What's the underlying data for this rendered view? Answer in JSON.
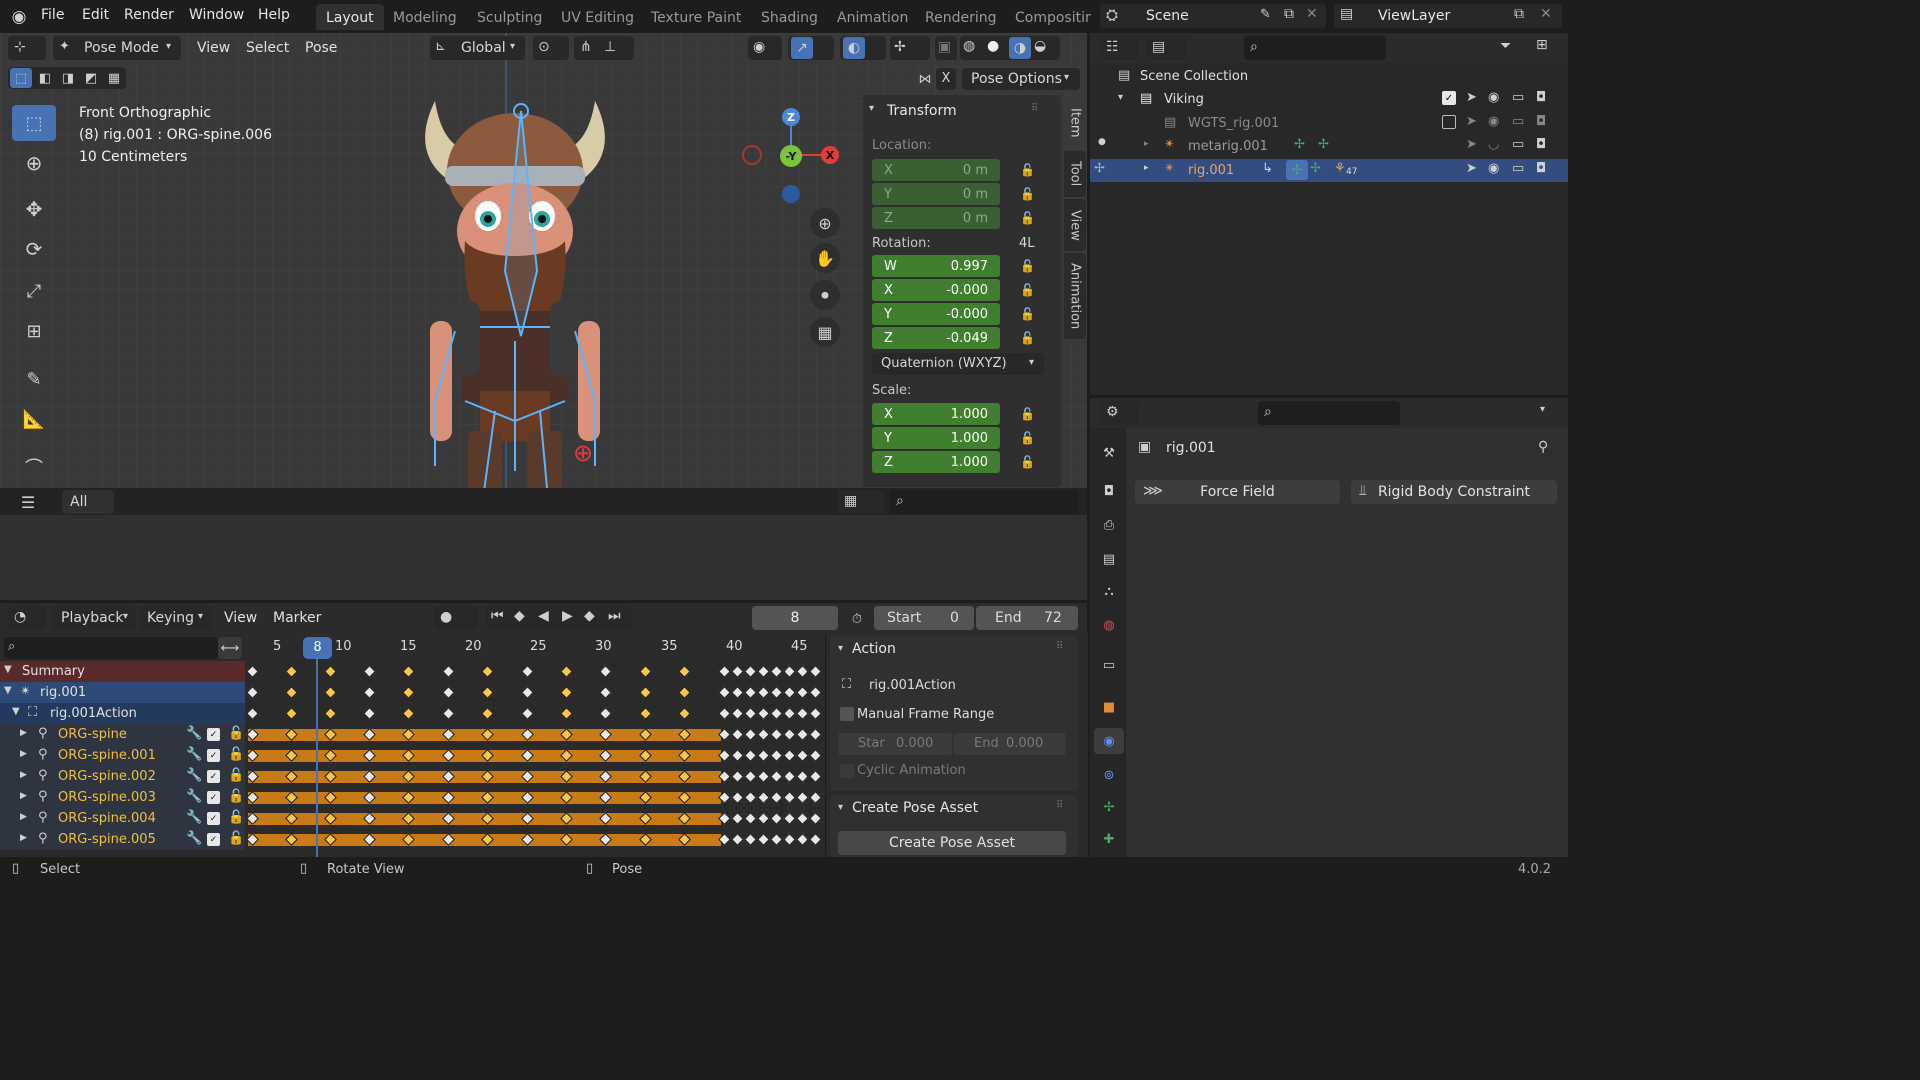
{
  "menu": {
    "file": "File",
    "edit": "Edit",
    "render": "Render",
    "window": "Window",
    "help": "Help"
  },
  "workspaces": [
    "Layout",
    "Modeling",
    "Sculpting",
    "UV Editing",
    "Texture Paint",
    "Shading",
    "Animation",
    "Rendering",
    "Compositing"
  ],
  "scene": {
    "name": "Scene",
    "view_layer": "ViewLayer"
  },
  "viewport": {
    "mode": "Pose Mode",
    "view": "View",
    "select": "Select",
    "pose": "Pose",
    "transform_orientation": "Global",
    "info_line1": "Front Orthographic",
    "info_line2": "(8) rig.001 : ORG-spine.006",
    "info_line3": "10 Centimeters",
    "pose_options": "Pose Options",
    "x_button": "X",
    "filter_all": "All"
  },
  "gizmo": {
    "z": "Z",
    "y": "-Y",
    "x": "X"
  },
  "npanel": {
    "transform_header": "Transform",
    "location_label": "Location:",
    "location": [
      {
        "axis": "X",
        "value": "0 m"
      },
      {
        "axis": "Y",
        "value": "0 m"
      },
      {
        "axis": "Z",
        "value": "0 m"
      }
    ],
    "rotation_label": "Rotation:",
    "rotation_mode_short": "4L",
    "rotation": [
      {
        "axis": "W",
        "value": "0.997"
      },
      {
        "axis": "X",
        "value": "-0.000"
      },
      {
        "axis": "Y",
        "value": "-0.000"
      },
      {
        "axis": "Z",
        "value": "-0.049"
      }
    ],
    "rotation_mode": "Quaternion (WXYZ)",
    "scale_label": "Scale:",
    "scale": [
      {
        "axis": "X",
        "value": "1.000"
      },
      {
        "axis": "Y",
        "value": "1.000"
      },
      {
        "axis": "Z",
        "value": "1.000"
      }
    ],
    "tabs": [
      "Item",
      "Tool",
      "View",
      "Animation"
    ]
  },
  "outliner": {
    "scene_collection": "Scene Collection",
    "items": [
      {
        "label": "Viking"
      },
      {
        "label": "WGTS_rig.001"
      },
      {
        "label": "metarig.001"
      },
      {
        "label": "rig.001",
        "badge": "47"
      }
    ]
  },
  "properties": {
    "object_name": "rig.001",
    "force_field": "Force Field",
    "rigid_body_constraint": "Rigid Body Constraint"
  },
  "timeline": {
    "playback": "Playback",
    "keying": "Keying",
    "view": "View",
    "marker": "Marker",
    "current_frame": "8",
    "start_label": "Start",
    "start": "0",
    "end_label": "End",
    "end": "72",
    "ruler": [
      "5",
      "8",
      "10",
      "15",
      "20",
      "25",
      "30",
      "35",
      "40",
      "45"
    ]
  },
  "dopesheet": {
    "channels": [
      {
        "label": "Summary"
      },
      {
        "label": "rig.001"
      },
      {
        "label": "rig.001Action"
      },
      {
        "label": "ORG-spine"
      },
      {
        "label": "ORG-spine.001"
      },
      {
        "label": "ORG-spine.002"
      },
      {
        "label": "ORG-spine.003"
      },
      {
        "label": "ORG-spine.004"
      },
      {
        "label": "ORG-spine.005"
      }
    ]
  },
  "action_panel": {
    "header": "Action",
    "action_name": "rig.001Action",
    "manual_frame_range": "Manual Frame Range",
    "start_label": "Star",
    "start": "0.000",
    "end_label": "End",
    "end": "0.000",
    "cyclic": "Cyclic Animation",
    "pose_asset_header": "Create Pose Asset",
    "pose_asset_button": "Create Pose Asset"
  },
  "statusbar": {
    "select": "Select",
    "rotate_view": "Rotate View",
    "pose": "Pose",
    "version": "4.0.2"
  },
  "colors": {
    "accent": "#4772b3",
    "keyframe": "#f5c64a",
    "channel_track": "#c77a16",
    "green_field": "#3f7f2f"
  }
}
